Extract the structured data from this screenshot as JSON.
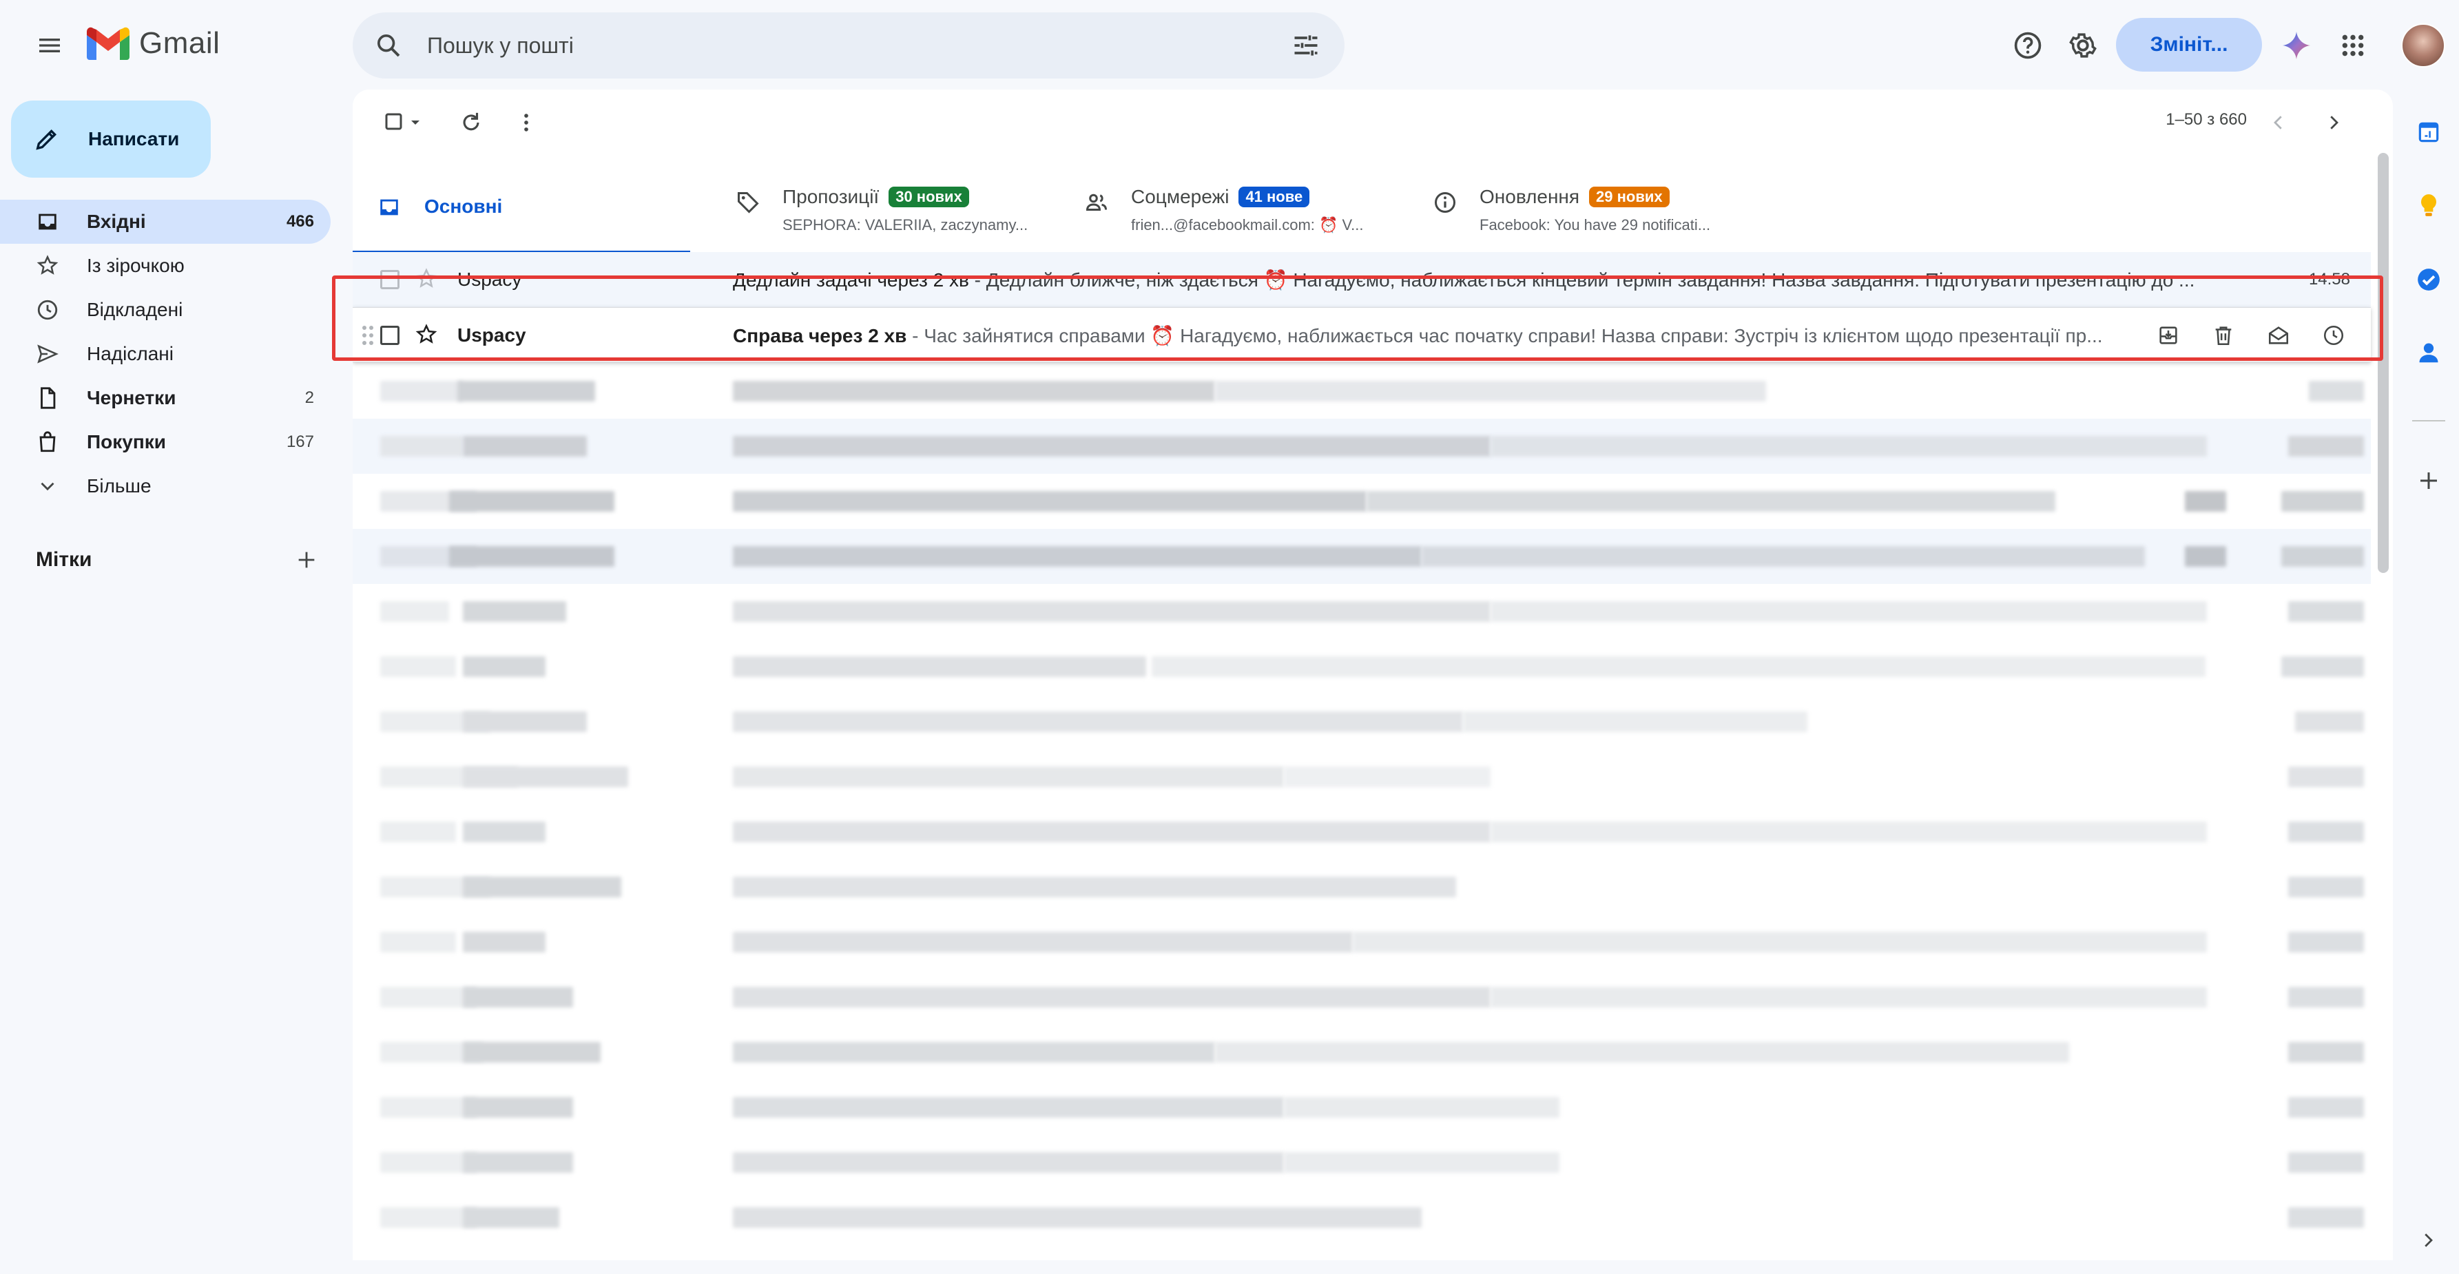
{
  "app": {
    "name": "Gmail"
  },
  "search": {
    "placeholder": "Пошук у пошті"
  },
  "header": {
    "upgrade_label": "Змініт..."
  },
  "compose": {
    "label": "Написати"
  },
  "nav": [
    {
      "label": "Вхідні",
      "count": "466",
      "icon": "inbox-icon",
      "active": true,
      "bold": true
    },
    {
      "label": "Із зірочкою",
      "count": "",
      "icon": "star-icon"
    },
    {
      "label": "Відкладені",
      "count": "",
      "icon": "clock-icon"
    },
    {
      "label": "Надіслані",
      "count": "",
      "icon": "send-icon"
    },
    {
      "label": "Чернетки",
      "count": "2",
      "icon": "draft-icon",
      "bold": true
    },
    {
      "label": "Покупки",
      "count": "167",
      "icon": "shopping-bag-icon",
      "bold": true
    },
    {
      "label": "Більше",
      "count": "",
      "icon": "chevron-down-icon"
    }
  ],
  "labels": {
    "title": "Мітки"
  },
  "toolbar": {
    "pager": "1–50 з 660"
  },
  "tabs": [
    {
      "name": "Основні",
      "badge": "",
      "snippet": ""
    },
    {
      "name": "Пропозиції",
      "badge": "30 нових",
      "badge_color": "#188038",
      "snippet": "SEPHORA: VALERIIA, zaczynamy..."
    },
    {
      "name": "Соцмережі",
      "badge": "41 нове",
      "badge_color": "#0b57d0",
      "snippet": "frien...@facebookmail.com: ⏰ V..."
    },
    {
      "name": "Оновлення",
      "badge": "29 нових",
      "badge_color": "#e37400",
      "snippet": "Facebook: You have 29 notificati..."
    }
  ],
  "emails": [
    {
      "sender": "Uspacy",
      "subject": "Дедлайн задачі через 2 хв",
      "snippet": " - Дедлайн ближче, ніж здається ⏰ Нагадуємо, наближається кінцевий термін завдання! Назва завдання: Підготувати презентацію до ...",
      "time": "14:58",
      "unread": false
    },
    {
      "sender": "Uspacy",
      "subject": "Справа через 2 хв",
      "snippet": " - Час зайнятися справами ⏰ Нагадуємо, наближається час початку справи! Назва справи: Зустріч із клієнтом щодо презентації пр...",
      "time": "",
      "unread": true,
      "hovered": true
    }
  ],
  "colors": {
    "accent": "#0b57d0",
    "highlight": "#e53935",
    "compose_bg": "#c2e7ff",
    "active_nav": "#d3e3fd"
  }
}
